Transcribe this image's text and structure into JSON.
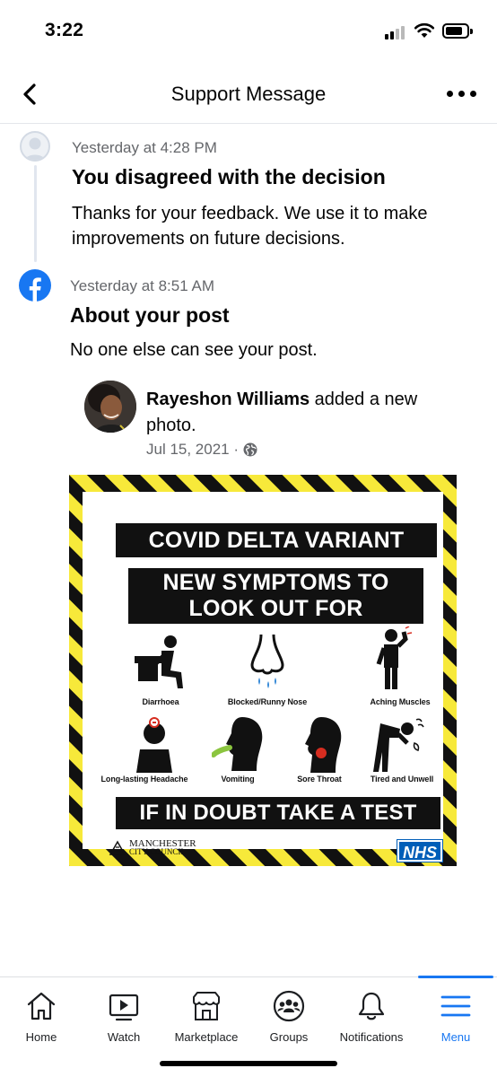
{
  "status_bar": {
    "time": "3:22"
  },
  "header": {
    "title": "Support Message"
  },
  "messages": [
    {
      "timestamp": "Yesterday at 4:28 PM",
      "title": "You disagreed with the decision",
      "body": "Thanks for your feedback. We use it to make improvements on future decisions."
    },
    {
      "timestamp": "Yesterday at 8:51 AM",
      "title": "About your post",
      "body": "No one else can see your post."
    }
  ],
  "post": {
    "author": "Rayeshon Williams",
    "action": " added a new photo.",
    "date": "Jul 15, 2021 ·",
    "privacy_icon": "globe-icon"
  },
  "poster": {
    "headline": "COVID DELTA VARIANT",
    "subheadline_line1": "NEW SYMPTOMS TO",
    "subheadline_line2": "LOOK OUT FOR",
    "symptoms": [
      "Diarrhoea",
      "Blocked/Runny Nose",
      "Aching Muscles",
      "Long-lasting Headache",
      "Vomiting",
      "Sore Throat",
      "Tired and Unwell"
    ],
    "cta": "IF IN DOUBT TAKE A TEST",
    "council_line1": "MANCHESTER",
    "council_line2": "CITY COUNCIL",
    "nhs": "NHS",
    "colors": {
      "stripe_yellow": "#f7e93a",
      "stripe_black": "#111111",
      "accent_blue": "#2f86d6",
      "accent_red": "#d62d20",
      "accent_green": "#8bc53f"
    }
  },
  "tabs": [
    {
      "label": "Home",
      "icon": "home-icon"
    },
    {
      "label": "Watch",
      "icon": "watch-icon"
    },
    {
      "label": "Marketplace",
      "icon": "marketplace-icon"
    },
    {
      "label": "Groups",
      "icon": "groups-icon"
    },
    {
      "label": "Notifications",
      "icon": "bell-icon"
    },
    {
      "label": "Menu",
      "icon": "menu-icon",
      "active": true
    }
  ],
  "colors": {
    "brand_blue": "#1877f2",
    "meta_gray": "#65676b"
  }
}
